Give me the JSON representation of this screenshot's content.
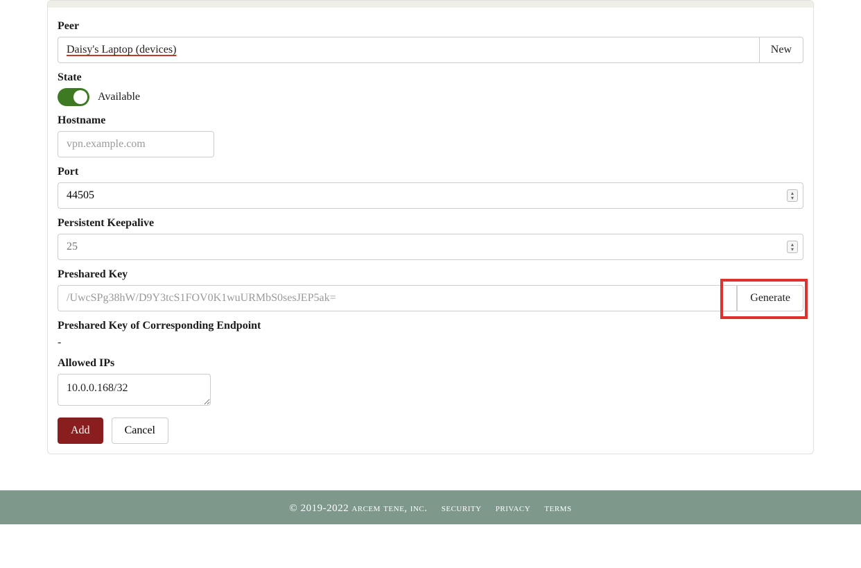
{
  "form": {
    "peer_label": "Peer",
    "peer_value": "Daisy's Laptop (devices)",
    "peer_new": "New",
    "state_label": "State",
    "state_text": "Available",
    "hostname_label": "Hostname",
    "hostname_placeholder": "vpn.example.com",
    "hostname_value": "",
    "port_label": "Port",
    "port_value": "44505",
    "keepalive_label": "Persistent Keepalive",
    "keepalive_placeholder": "25",
    "keepalive_value": "",
    "psk_label": "Preshared Key",
    "psk_placeholder": "/UwcSPg38hW/D9Y3tcS1FOV0K1wuURMbS0sesJEP5ak=",
    "psk_value": "",
    "psk_generate": "Generate",
    "psk_corr_label": "Preshared Key of Corresponding Endpoint",
    "psk_corr_value": "-",
    "allowed_label": "Allowed IPs",
    "allowed_value": "10.0.0.168/32",
    "add": "Add",
    "cancel": "Cancel"
  },
  "footer": {
    "copyright": "© 2019-2022 arcem tene, inc.",
    "security": "security",
    "privacy": "privacy",
    "terms": "terms"
  }
}
